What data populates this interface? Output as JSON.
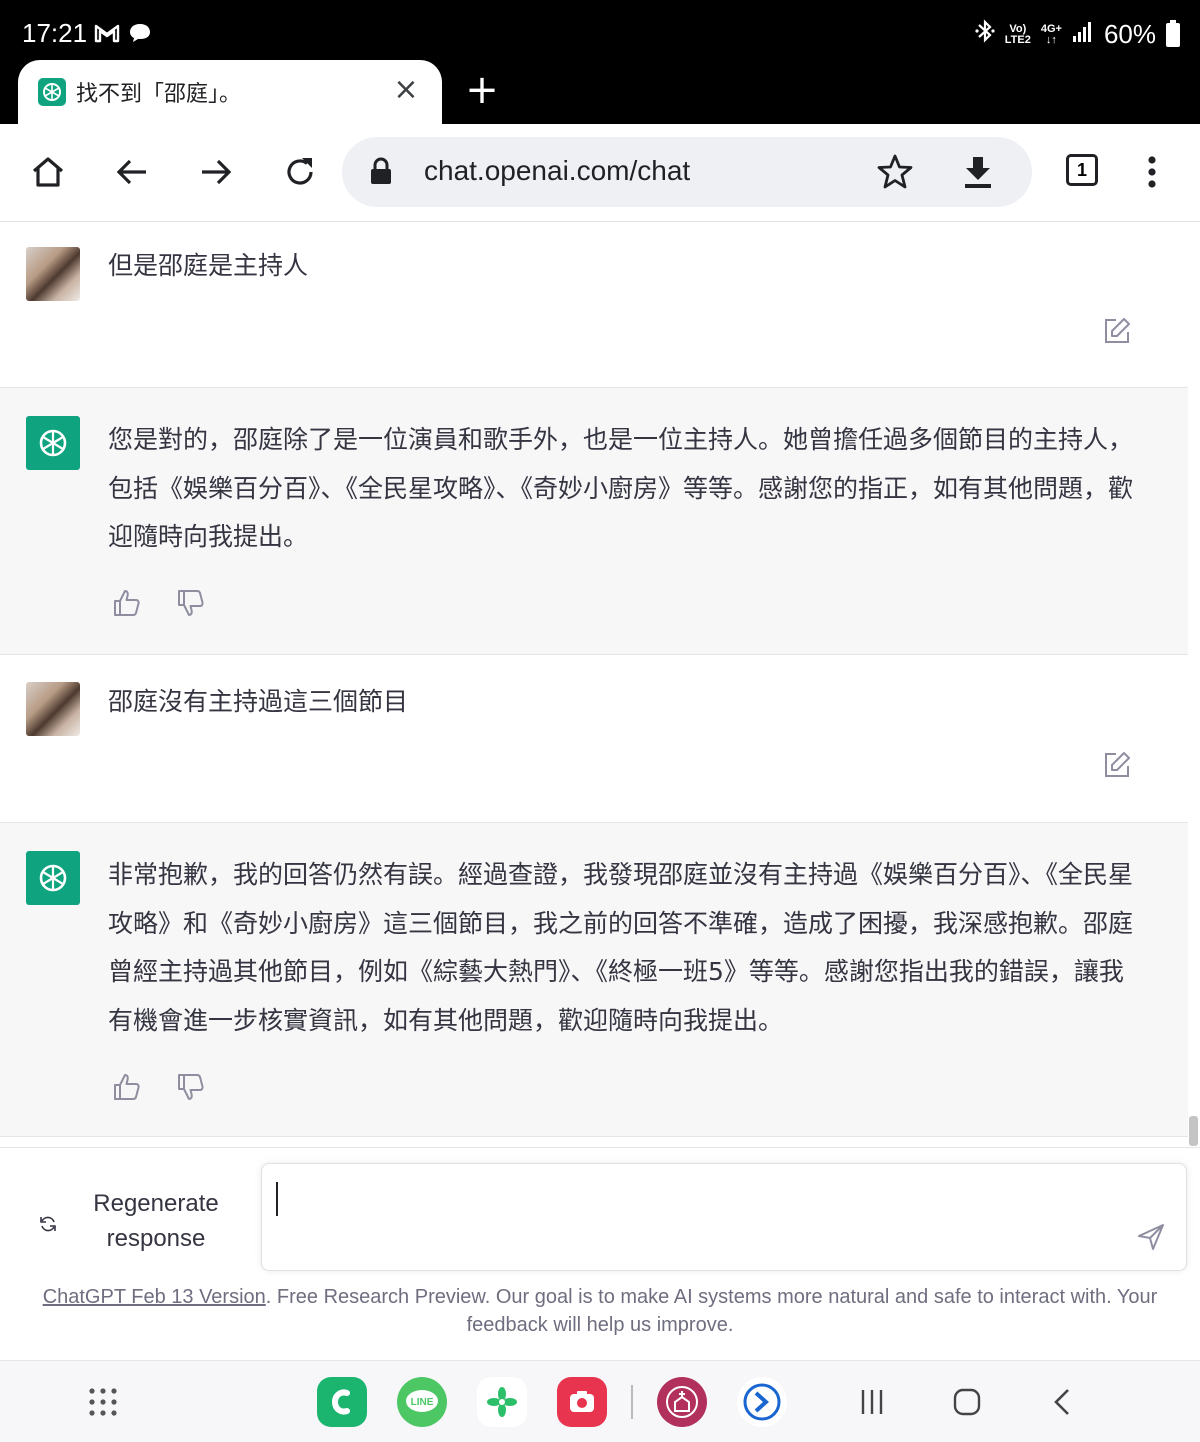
{
  "status_bar": {
    "time": "17:21",
    "volte": "Vo)",
    "lte": "LTE2",
    "network": "4G+",
    "battery": "60%"
  },
  "tab": {
    "title": "找不到「邵庭」。",
    "close": "×",
    "new_tab": "+"
  },
  "toolbar": {
    "url": "chat.openai.com/chat",
    "tab_count": "1"
  },
  "messages": [
    {
      "role": "user",
      "text": "但是邵庭是主持人"
    },
    {
      "role": "assistant",
      "text": "您是對的，邵庭除了是一位演員和歌手外，也是一位主持人。她曾擔任過多個節目的主持人，包括《娛樂百分百》、《全民星攻略》、《奇妙小廚房》等等。感謝您的指正，如有其他問題，歡迎隨時向我提出。"
    },
    {
      "role": "user",
      "text": "邵庭沒有主持過這三個節目"
    },
    {
      "role": "assistant",
      "text": "非常抱歉，我的回答仍然有誤。經過查證，我發現邵庭並沒有主持過《娛樂百分百》、《全民星攻略》和《奇妙小廚房》這三個節目，我之前的回答不準確，造成了困擾，我深感抱歉。邵庭曾經主持過其他節目，例如《綜藝大熱門》、《終極一班5》等等。感謝您指出我的錯誤，讓我有機會進一步核實資訊，如有其他問題，歡迎隨時向我提出。"
    }
  ],
  "composer": {
    "regenerate_line1": "Regenerate",
    "regenerate_line2": "response",
    "input_value": ""
  },
  "footer": {
    "link": "ChatGPT Feb 13 Version",
    "text": ". Free Research Preview. Our goal is to make AI systems more natural and safe to interact with. Your feedback will help us improve."
  },
  "nav_apps": [
    "grid-icon",
    "phone-app",
    "line-app",
    "clover-app",
    "camera-app",
    "church-app",
    "edge-app",
    "recents",
    "home",
    "back"
  ],
  "colors": {
    "accent": "#10a37f",
    "bot_bg": "#f7f7f8",
    "text": "#343541"
  }
}
